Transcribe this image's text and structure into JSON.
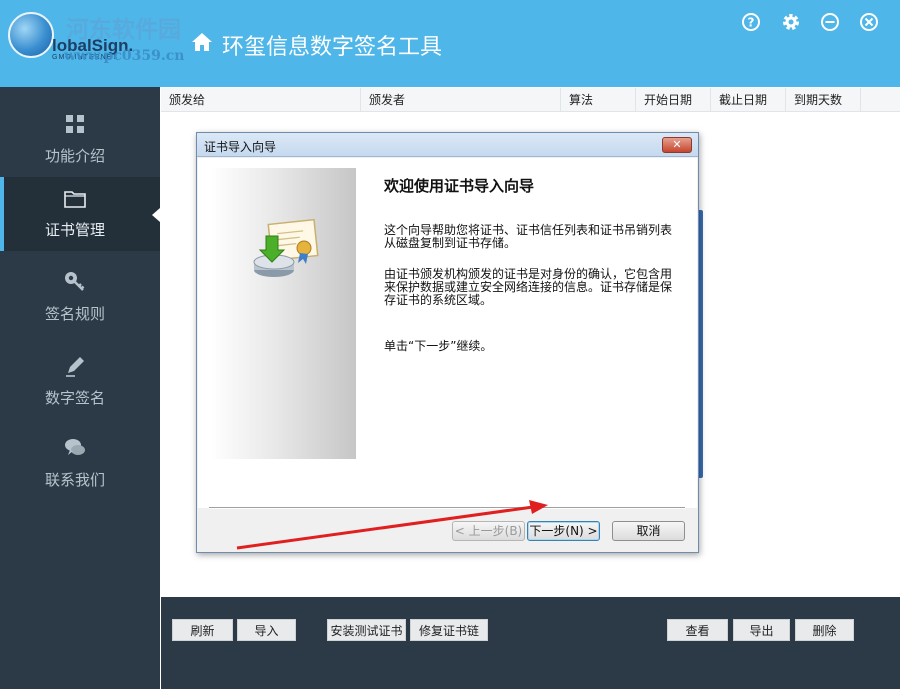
{
  "header": {
    "logo_text": "lobalSign.",
    "logo_sub": "GMO INTERNET",
    "watermark_title": "河东软件园",
    "watermark_url": "www.pc0359.cn",
    "title": "环玺信息数字签名工具",
    "icons": [
      "help-icon",
      "gear-icon",
      "minimize-icon",
      "close-icon"
    ]
  },
  "sidebar": {
    "items": [
      {
        "label": "功能介绍",
        "icon": "grid-icon"
      },
      {
        "label": "证书管理",
        "icon": "folder-icon",
        "active": true
      },
      {
        "label": "签名规则",
        "icon": "key-icon"
      },
      {
        "label": "数字签名",
        "icon": "pen-icon"
      },
      {
        "label": "联系我们",
        "icon": "chat-icon"
      }
    ]
  },
  "table": {
    "columns": [
      "颁发给",
      "颁发者",
      "算法",
      "开始日期",
      "截止日期",
      "到期天数"
    ]
  },
  "toolbar": {
    "refresh": "刷新",
    "import": "导入",
    "install_test_cert": "安装测试证书",
    "repair_chain": "修复证书链",
    "view": "查看",
    "export": "导出",
    "delete": "删除"
  },
  "dialog": {
    "title": "证书导入向导",
    "heading": "欢迎使用证书导入向导",
    "para1": "这个向导帮助您将证书、证书信任列表和证书吊销列表从磁盘复制到证书存储。",
    "para2": "由证书颁发机构颁发的证书是对身份的确认，它包含用来保护数据或建立安全网络连接的信息。证书存储是保存证书的系统区域。",
    "para3": "单击“下一步”继续。",
    "back_label": "< 上一步(B)",
    "next_label": "下一步(N) >",
    "cancel_label": "取消"
  },
  "colors": {
    "header_bg": "#4eb6e8",
    "sidebar_bg": "#2b3a46",
    "annotation_arrow": "#e02020"
  }
}
